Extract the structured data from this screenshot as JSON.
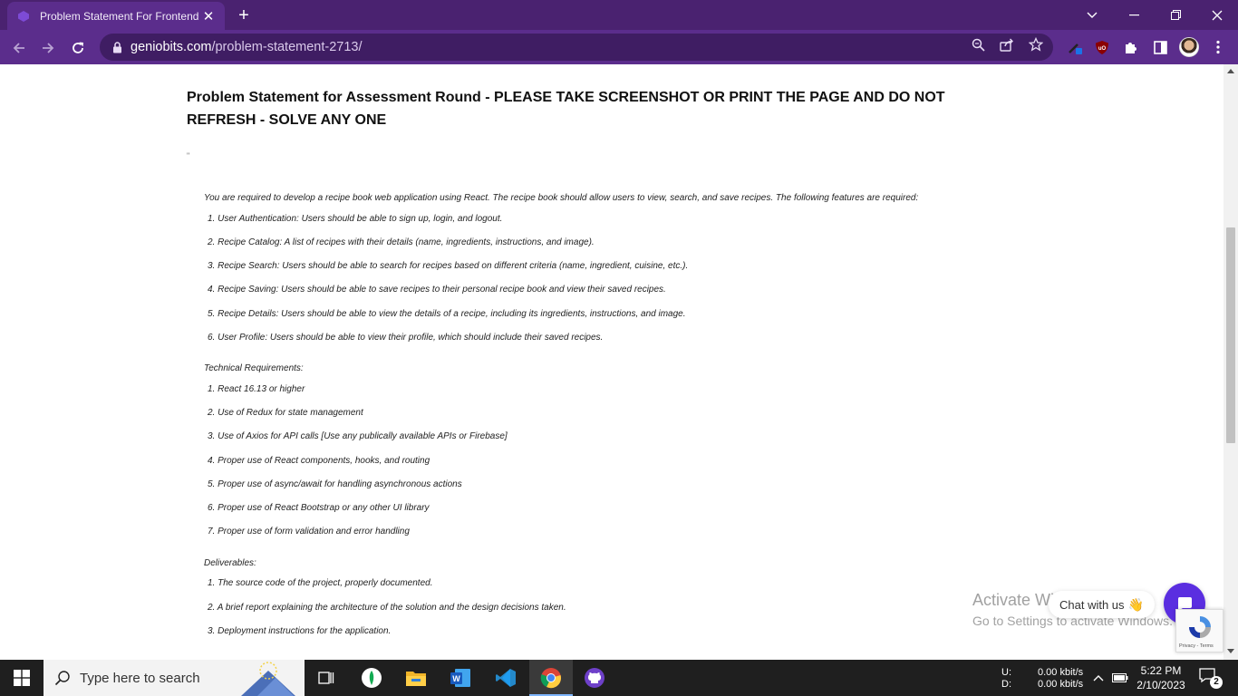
{
  "browser": {
    "tab_title": "Problem Statement For Frontend",
    "url_host": "geniobits.com",
    "url_path": "/problem-statement-2713/"
  },
  "page": {
    "heading": "Problem Statement for Assessment Round - PLEASE TAKE SCREENSHOT OR PRINT THE PAGE AND DO NOT REFRESH - SOLVE ANY ONE",
    "quote": "\"",
    "intro": "You are required to develop a recipe book web application using React. The recipe book should allow users to view, search, and save recipes. The following features are required:",
    "features": [
      "1. User Authentication: Users should be able to sign up, login, and logout.",
      "2. Recipe Catalog: A list of recipes with their details (name, ingredients, instructions, and image).",
      "3. Recipe Search: Users should be able to search for recipes based on different criteria (name, ingredient, cuisine, etc.).",
      "4. Recipe Saving: Users should be able to save recipes to their personal recipe book and view their saved recipes.",
      "5. Recipe Details: Users should be able to view the details of a recipe, including its ingredients, instructions, and image.",
      "6. User Profile: Users should be able to view their profile, which should include their saved recipes."
    ],
    "tech_label": "Technical Requirements:",
    "tech": [
      "1. React 16.13 or higher",
      "2. Use of Redux for state management",
      "3. Use of Axios for API calls [Use any publically available APIs or Firebase]",
      "4. Proper use of React components, hooks, and routing",
      "5. Proper use of async/await for handling asynchronous actions",
      "6. Proper use of React Bootstrap or any other UI library",
      "7. Proper use of form validation and error handling"
    ],
    "deliverables_label": "Deliverables:",
    "deliverables": [
      "1. The source code of the project, properly documented.",
      "2. A brief report explaining the architecture of the solution and the design decisions taken.",
      "3. Deployment instructions for the application."
    ]
  },
  "overlays": {
    "watermark_line1": "Activate Windows",
    "watermark_line2": "Go to Settings to activate Windows.",
    "chat_label": "Chat with us",
    "chat_emoji": "👋",
    "recaptcha_terms": "Privacy - Terms"
  },
  "taskbar": {
    "search_placeholder": "Type here to search",
    "net_labels": [
      "U:",
      "D:"
    ],
    "net_up": "0.00 kbit/s",
    "net_down": "0.00 kbit/s",
    "time": "5:22 PM",
    "date": "2/10/2023",
    "notification_count": "2"
  },
  "colors": {
    "browser_frame": "#4a2270",
    "browser_toolbar": "#5b2d8c",
    "chat_accent": "#5a2ee0",
    "taskbar": "#1f1f1f"
  }
}
